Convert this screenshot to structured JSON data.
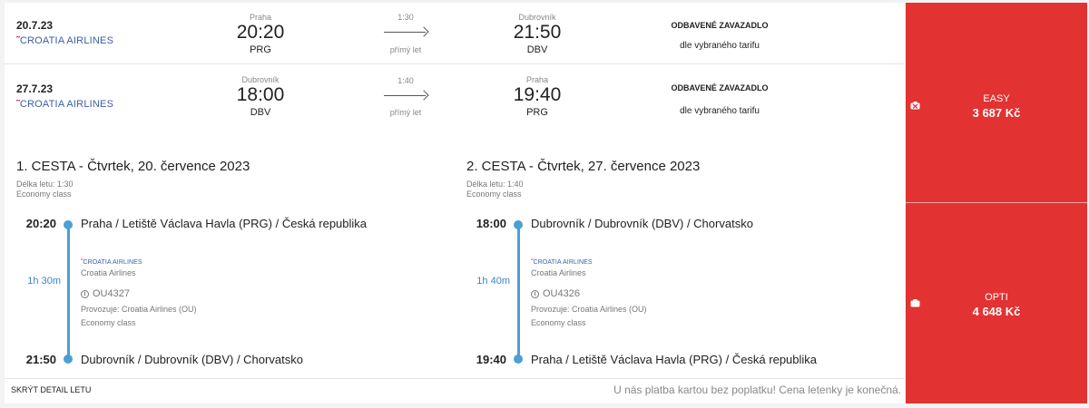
{
  "legs": [
    {
      "date": "20.7.23",
      "airline": "CROATIA AIRLINES",
      "from": {
        "city": "Praha",
        "time": "20:20",
        "code": "PRG"
      },
      "duration": "1:30",
      "direct": "přímý let",
      "to": {
        "city": "Dubrovník",
        "time": "21:50",
        "code": "DBV"
      },
      "baggage_title": "ODBAVENÉ ZAVAZADLO",
      "baggage_value": "dle vybraného tarifu"
    },
    {
      "date": "27.7.23",
      "airline": "CROATIA AIRLINES",
      "from": {
        "city": "Dubrovník",
        "time": "18:00",
        "code": "DBV"
      },
      "duration": "1:40",
      "direct": "přímý let",
      "to": {
        "city": "Praha",
        "time": "19:40",
        "code": "PRG"
      },
      "baggage_title": "ODBAVENÉ ZAVAZADLO",
      "baggage_value": "dle vybraného tarifu"
    }
  ],
  "details": [
    {
      "title": "1. CESTA - Čtvrtek, 20. července 2023",
      "length": "Délka letu: 1:30",
      "cabin": "Economy class",
      "dep_time": "20:20",
      "dep_place": "Praha / Letiště Václava Havla (PRG) / Česká republika",
      "duration": "1h 30m",
      "logo": "CROATIA AIRLINES",
      "carrier": "Croatia Airlines",
      "flight": "OU4327",
      "operated": "Provozuje: Croatia Airlines (OU)",
      "class": "Economy class",
      "arr_time": "21:50",
      "arr_place": "Dubrovník / Dubrovník (DBV) / Chorvatsko"
    },
    {
      "title": "2. CESTA - Čtvrtek, 27. července 2023",
      "length": "Délka letu: 1:40",
      "cabin": "Economy class",
      "dep_time": "18:00",
      "dep_place": "Dubrovník / Dubrovník (DBV) / Chorvatsko",
      "duration": "1h 40m",
      "logo": "CROATIA AIRLINES",
      "carrier": "Croatia Airlines",
      "flight": "OU4326",
      "operated": "Provozuje: Croatia Airlines (OU)",
      "class": "Economy class",
      "arr_time": "19:40",
      "arr_place": "Praha / Letiště Václava Havla (PRG) / Česká republika"
    }
  ],
  "footer": {
    "hide_detail": "SKRÝT DETAIL LETU",
    "note": "U nás platba kartou bez poplatku! Cena letenky je konečná."
  },
  "fares": [
    {
      "name": "EASY",
      "price": "3 687 Kč",
      "icon": "no-baggage-icon"
    },
    {
      "name": "OPTI",
      "price": "4 648 Kč",
      "icon": "suitcase-icon"
    }
  ],
  "colors": {
    "accent": "#e23232",
    "timeline": "#4b9fd5",
    "airline_blue": "#3a5ea8"
  }
}
